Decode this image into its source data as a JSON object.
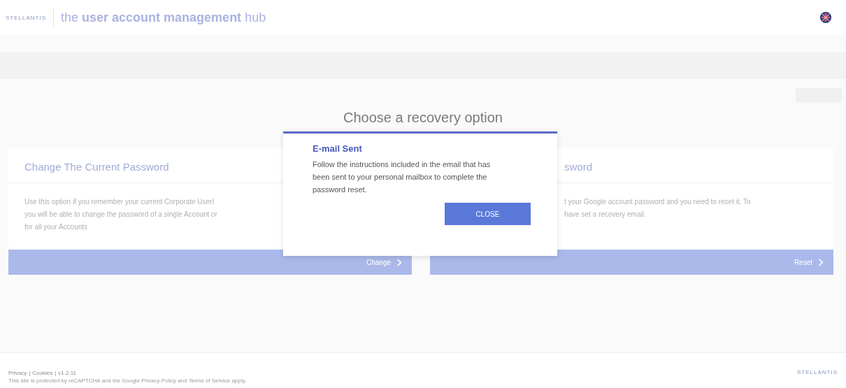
{
  "header": {
    "logo": "STELLANTIS",
    "title": "the **user account management** hub"
  },
  "page": {
    "heading": "Choose a recovery option"
  },
  "cards": [
    {
      "title": "Change The Current Password",
      "lines": [
        "Use this option if you remember your current Corporate UserI",
        "you will be able to change the password of a single Account or",
        "for all your Accounts"
      ],
      "action": "Change"
    },
    {
      "title": "sword",
      "lines": [
        "t your Google account password and you need to reset it. To",
        "have set a recovery email."
      ],
      "action": "Reset"
    }
  ],
  "dialog": {
    "title": "E-mail Sent",
    "message": "Follow the instructions included in the email that has been sent to your personal mailbox to complete the password reset.",
    "button": "CLOSE"
  },
  "footer": {
    "links": [
      "Privacy",
      "Cookies"
    ],
    "separator": "|",
    "version": "v1.2.11",
    "notice": "This site is protected by reCAPTCHA and the Google Privacy Policy and Terms of Service apply.",
    "logo": "STELLANTIS"
  }
}
